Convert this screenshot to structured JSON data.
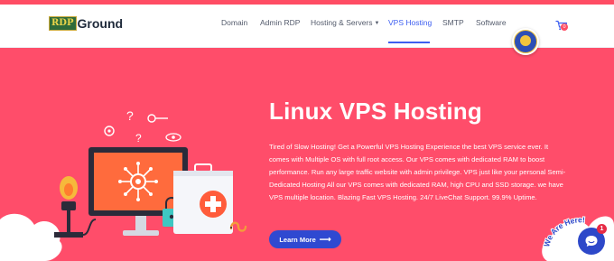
{
  "brand": {
    "logo_badge": "RDP",
    "logo_text": "Ground"
  },
  "nav": {
    "items": [
      {
        "label": "Domain"
      },
      {
        "label": "Admin RDP"
      },
      {
        "label": "Hosting & Servers"
      },
      {
        "label": "VPS Hosting",
        "active": true
      },
      {
        "label": "SMTP"
      },
      {
        "label": "Software"
      }
    ],
    "cart_count": "0"
  },
  "hero": {
    "title": "Linux VPS Hosting",
    "description": "Tired of Slow Hosting! Get a Powerful VPS Hosting Experience the best VPS service ever. It comes with Multiple OS with full root access. Our VPS comes with dedicated RAM to boost performance. Run any large traffic website with admin privilege. VPS just like your personal Semi-Dedicated Hosting All our VPS comes with dedicated RAM, high CPU and SSD storage. we have VPS multiple location. Blazing Fast VPS Hosting. 24/7 LiveChat Support. 99.9% Uptime.",
    "button_label": "Learn More"
  },
  "chat": {
    "badge_text": "We Are Here!",
    "unread_count": "1"
  },
  "colors": {
    "hero_bg": "#ff4d6a",
    "accent": "#3d5ef0",
    "button_bg": "#2f49d1"
  }
}
